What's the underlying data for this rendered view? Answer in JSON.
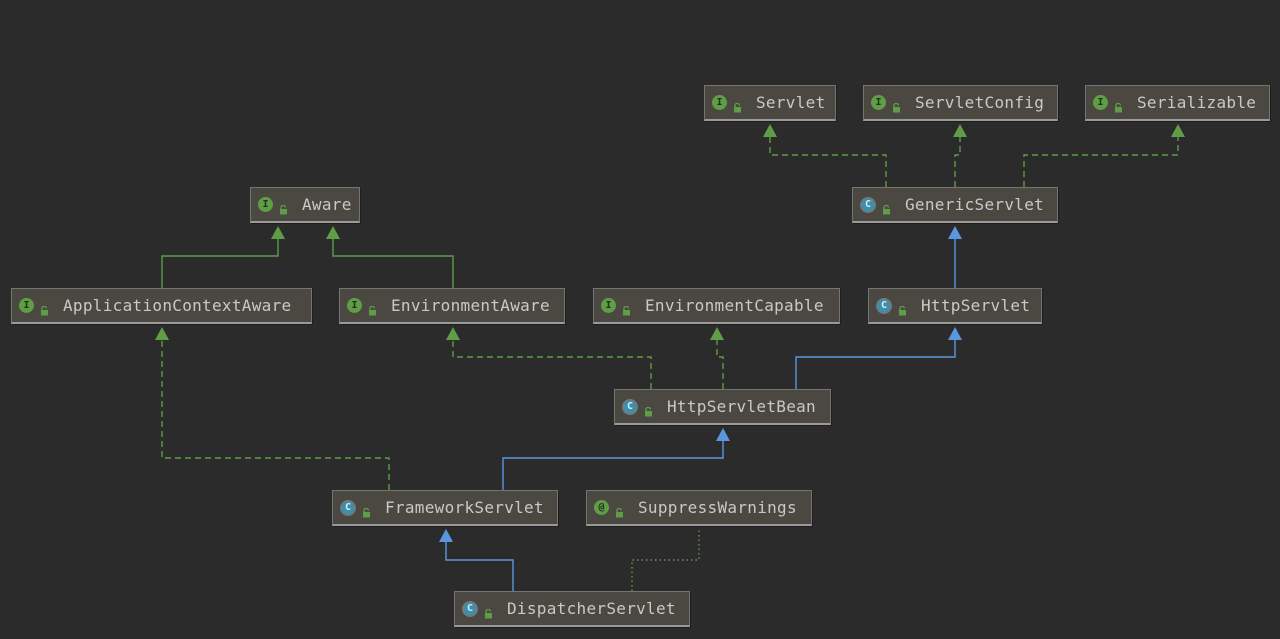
{
  "diagram": {
    "nodes": [
      {
        "id": "servlet",
        "name": "Servlet",
        "kind": "interface",
        "kind_glyph": "I"
      },
      {
        "id": "servlet-config",
        "name": "ServletConfig",
        "kind": "interface",
        "kind_glyph": "I"
      },
      {
        "id": "serializable",
        "name": "Serializable",
        "kind": "interface",
        "kind_glyph": "I"
      },
      {
        "id": "aware",
        "name": "Aware",
        "kind": "interface",
        "kind_glyph": "I"
      },
      {
        "id": "generic-servlet",
        "name": "GenericServlet",
        "kind": "class",
        "kind_glyph": "C"
      },
      {
        "id": "application-context-aware",
        "name": "ApplicationContextAware",
        "kind": "interface",
        "kind_glyph": "I"
      },
      {
        "id": "environment-aware",
        "name": "EnvironmentAware",
        "kind": "interface",
        "kind_glyph": "I"
      },
      {
        "id": "environment-capable",
        "name": "EnvironmentCapable",
        "kind": "interface",
        "kind_glyph": "I"
      },
      {
        "id": "http-servlet",
        "name": "HttpServlet",
        "kind": "class",
        "kind_glyph": "C"
      },
      {
        "id": "http-servlet-bean",
        "name": "HttpServletBean",
        "kind": "class",
        "kind_glyph": "C"
      },
      {
        "id": "framework-servlet",
        "name": "FrameworkServlet",
        "kind": "class",
        "kind_glyph": "C"
      },
      {
        "id": "suppress-warnings",
        "name": "SuppressWarnings",
        "kind": "annotation",
        "kind_glyph": "@"
      },
      {
        "id": "dispatcher-servlet",
        "name": "DispatcherServlet",
        "kind": "class",
        "kind_glyph": "C"
      }
    ],
    "edges": [
      {
        "from": "generic-servlet",
        "to": "servlet",
        "type": "implements"
      },
      {
        "from": "generic-servlet",
        "to": "servlet-config",
        "type": "implements"
      },
      {
        "from": "generic-servlet",
        "to": "serializable",
        "type": "implements"
      },
      {
        "from": "application-context-aware",
        "to": "aware",
        "type": "extends-interface"
      },
      {
        "from": "environment-aware",
        "to": "aware",
        "type": "extends-interface"
      },
      {
        "from": "http-servlet",
        "to": "generic-servlet",
        "type": "extends"
      },
      {
        "from": "http-servlet-bean",
        "to": "environment-aware",
        "type": "implements"
      },
      {
        "from": "http-servlet-bean",
        "to": "environment-capable",
        "type": "implements"
      },
      {
        "from": "http-servlet-bean",
        "to": "http-servlet",
        "type": "extends"
      },
      {
        "from": "framework-servlet",
        "to": "application-context-aware",
        "type": "implements"
      },
      {
        "from": "framework-servlet",
        "to": "http-servlet-bean",
        "type": "extends"
      },
      {
        "from": "dispatcher-servlet",
        "to": "framework-servlet",
        "type": "extends"
      },
      {
        "from": "dispatcher-servlet",
        "to": "suppress-warnings",
        "type": "annotated"
      }
    ],
    "colors": {
      "background": "#2b2b2b",
      "extends_line": "#5b97e0",
      "implements_line": "#5f9d47",
      "annotation_line": "#5f9d47",
      "interface_badge": "#5f9d47",
      "class_badge": "#3b90ad"
    }
  }
}
